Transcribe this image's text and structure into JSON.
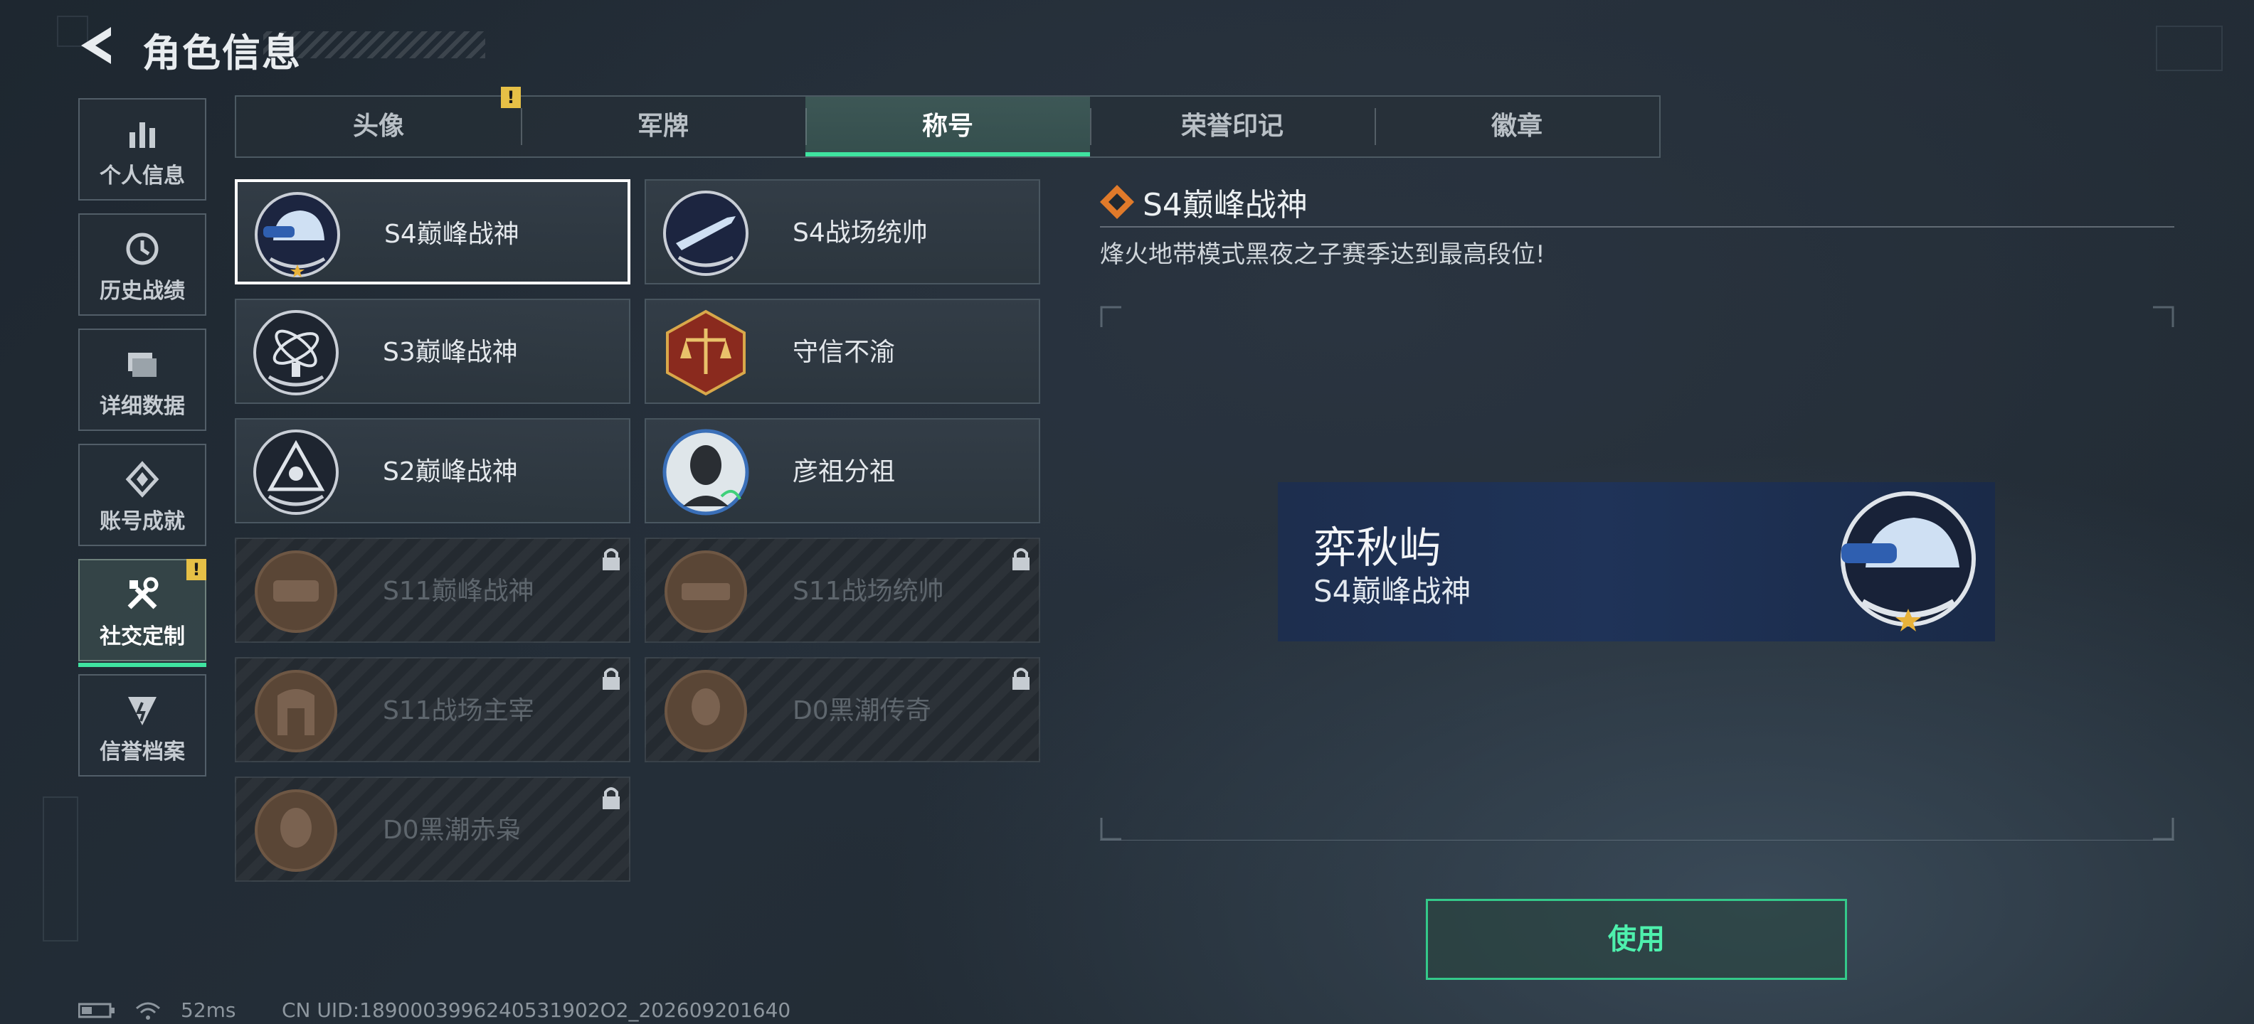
{
  "header": {
    "title": "角色信息"
  },
  "nav": [
    {
      "label": "个人信息",
      "icon": "bar-chart-icon"
    },
    {
      "label": "历史战绩",
      "icon": "history-icon"
    },
    {
      "label": "详细数据",
      "icon": "folder-icon"
    },
    {
      "label": "账号成就",
      "icon": "achievement-icon"
    },
    {
      "label": "社交定制",
      "icon": "tools-icon",
      "active": true,
      "badge": "!"
    },
    {
      "label": "信誉档案",
      "icon": "credit-icon"
    }
  ],
  "tabs": [
    {
      "label": "头像",
      "badge": "!"
    },
    {
      "label": "军牌"
    },
    {
      "label": "称号",
      "active": true
    },
    {
      "label": "荣誉印记"
    },
    {
      "label": "徽章"
    }
  ],
  "titles": [
    {
      "name": "S4巅峰战神",
      "selected": true,
      "locked": false
    },
    {
      "name": "S4战场统帅",
      "locked": false
    },
    {
      "name": "S3巅峰战神",
      "locked": false
    },
    {
      "name": "守信不渝",
      "locked": false
    },
    {
      "name": "S2巅峰战神",
      "locked": false
    },
    {
      "name": "彦祖分祖",
      "locked": false
    },
    {
      "name": "S11巅峰战神",
      "locked": true
    },
    {
      "name": "S11战场统帅",
      "locked": true
    },
    {
      "name": "S11战场主宰",
      "locked": true
    },
    {
      "name": "D0黑潮传奇",
      "locked": true
    },
    {
      "name": "D0黑潮赤枭",
      "locked": true
    }
  ],
  "detail": {
    "title": "S4巅峰战神",
    "description": "烽火地带模式黑夜之子赛季达到最高段位!",
    "preview": {
      "player_name": "弈秋屿",
      "title": "S4巅峰战神"
    },
    "use_button": "使用"
  },
  "status": {
    "ping": "52ms",
    "uid": "CN UID:1890003996240531902O2_202609201640"
  },
  "colors": {
    "accent": "#3fe3a0",
    "warning": "#e6c046",
    "use_button": "#4ef0ad"
  }
}
